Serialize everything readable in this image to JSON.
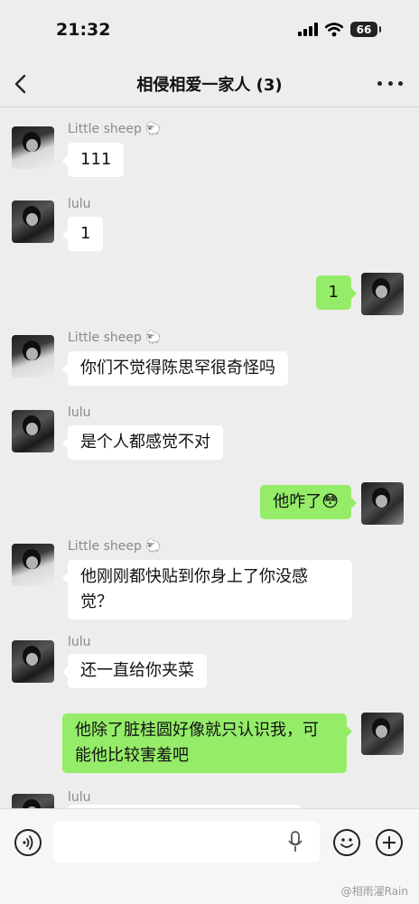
{
  "status_bar": {
    "time": "21:32",
    "battery": "66"
  },
  "header": {
    "title": "相侵相爱一家人 (3)"
  },
  "messages": [
    {
      "sender": "Little sheep 🐑",
      "text": "111"
    },
    {
      "sender": "lulu",
      "text": "1"
    },
    {
      "sender": "",
      "text": "1"
    },
    {
      "sender": "Little sheep 🐑",
      "text": "你们不觉得陈思罕很奇怪吗"
    },
    {
      "sender": "lulu",
      "text": "是个人都感觉不对"
    },
    {
      "sender": "",
      "text": "他咋了😳"
    },
    {
      "sender": "Little sheep 🐑",
      "text": "他刚刚都快贴到你身上了你没感觉？"
    },
    {
      "sender": "lulu",
      "text": "还一直给你夹菜"
    },
    {
      "sender": "",
      "text": "他除了脏桂圆好像就只认识我，可能他比较害羞吧"
    },
    {
      "sender": "lulu",
      "text": ""
    }
  ],
  "input_bar": {
    "placeholder": ""
  },
  "watermark": "@相雨濯Rain",
  "colors": {
    "background": "#ededed",
    "self_bubble": "#95ec69",
    "other_bubble": "#ffffff"
  },
  "icons": [
    "back-arrow-icon",
    "more-options-icon",
    "voice-input-icon",
    "microphone-icon",
    "emoji-icon",
    "plus-icon",
    "signal-icon",
    "wifi-icon",
    "battery-icon"
  ]
}
